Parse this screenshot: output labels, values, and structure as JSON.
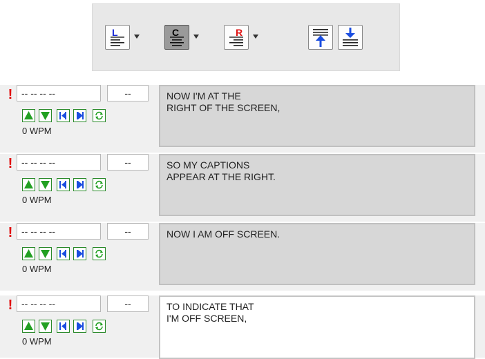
{
  "toolbar": {
    "buttons": [
      {
        "name": "align-left",
        "letter": "L",
        "letter_color": "#1a2ad8",
        "pressed": false,
        "has_dropdown": true
      },
      {
        "name": "align-center",
        "letter": "C",
        "letter_color": "#000000",
        "pressed": true,
        "has_dropdown": true
      },
      {
        "name": "align-right",
        "letter": "R",
        "letter_color": "#e01010",
        "pressed": false,
        "has_dropdown": true
      },
      {
        "name": "align-top",
        "icon": "arrow-up-icon",
        "pressed": false,
        "has_dropdown": false
      },
      {
        "name": "align-bottom",
        "icon": "arrow-down-icon",
        "pressed": false,
        "has_dropdown": false
      }
    ]
  },
  "rows": [
    {
      "alert": "!",
      "time": "-- -- -- --",
      "count": "--",
      "wpm": "0 WPM",
      "caption": [
        "NOW I'M AT THE",
        "RIGHT OF THE SCREEN,"
      ]
    },
    {
      "alert": "!",
      "time": "-- -- -- --",
      "count": "--",
      "wpm": "0 WPM",
      "caption": [
        "SO MY CAPTIONS",
        "APPEAR AT THE RIGHT."
      ]
    },
    {
      "alert": "!",
      "time": "-- -- -- --",
      "count": "--",
      "wpm": "0 WPM",
      "caption": [
        "NOW I AM OFF SCREEN.",
        ""
      ]
    },
    {
      "alert": "!",
      "time": "-- -- -- --",
      "count": "--",
      "wpm": "0 WPM",
      "caption": [
        "TO INDICATE THAT",
        "I'M OFF SCREEN,"
      ]
    }
  ],
  "colors": {
    "alert": "#e00000",
    "control_green": "#2aa02a",
    "caption_bg": "#d7d7d7",
    "caption_active_bg": "#ffffff"
  }
}
